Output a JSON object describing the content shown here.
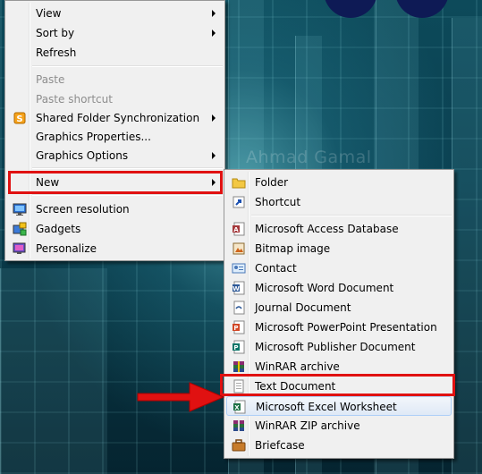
{
  "context_menu": {
    "items": [
      {
        "label": "View",
        "has_submenu": true
      },
      {
        "label": "Sort by",
        "has_submenu": true
      },
      {
        "label": "Refresh"
      },
      {
        "label": "Paste",
        "disabled": true
      },
      {
        "label": "Paste shortcut",
        "disabled": true
      },
      {
        "label": "Shared Folder Synchronization",
        "icon": "shared-folder-sync-icon",
        "has_submenu": true
      },
      {
        "label": "Graphics Properties..."
      },
      {
        "label": "Graphics Options",
        "has_submenu": true
      },
      {
        "label": "New",
        "has_submenu": true,
        "highlighted": true
      },
      {
        "label": "Screen resolution",
        "icon": "screen-resolution-icon"
      },
      {
        "label": "Gadgets",
        "icon": "gadgets-icon"
      },
      {
        "label": "Personalize",
        "icon": "personalize-icon"
      }
    ]
  },
  "new_submenu": {
    "items": [
      {
        "label": "Folder",
        "icon": "folder-icon"
      },
      {
        "label": "Shortcut",
        "icon": "shortcut-icon"
      },
      {
        "label": "Microsoft Access Database",
        "icon": "access-database-icon"
      },
      {
        "label": "Bitmap image",
        "icon": "bitmap-image-icon"
      },
      {
        "label": "Contact",
        "icon": "contact-icon"
      },
      {
        "label": "Microsoft Word Document",
        "icon": "word-document-icon"
      },
      {
        "label": "Journal Document",
        "icon": "journal-document-icon"
      },
      {
        "label": "Microsoft PowerPoint Presentation",
        "icon": "powerpoint-icon"
      },
      {
        "label": "Microsoft Publisher Document",
        "icon": "publisher-icon"
      },
      {
        "label": "WinRAR archive",
        "icon": "winrar-archive-icon"
      },
      {
        "label": "Text Document",
        "icon": "text-document-icon",
        "highlighted": true
      },
      {
        "label": "Microsoft Excel Worksheet",
        "icon": "excel-worksheet-icon"
      },
      {
        "label": "WinRAR ZIP archive",
        "icon": "winrar-zip-icon"
      },
      {
        "label": "Briefcase",
        "icon": "briefcase-icon"
      }
    ]
  },
  "watermark": "Ahmad Gamal",
  "colors": {
    "highlight_border": "#e01111",
    "menu_background": "#f0f0f0",
    "disabled_text": "#8d8d8d"
  }
}
